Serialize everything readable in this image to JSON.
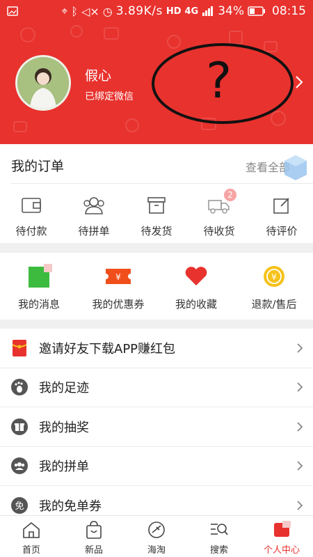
{
  "status_bar": {
    "speed": "3.89K/s",
    "hd": "HD",
    "net": "4G",
    "battery": "34%",
    "time": "08:15"
  },
  "profile": {
    "username": "假心",
    "wechat_status": "已绑定微信",
    "scribble_text": "?"
  },
  "orders": {
    "title": "我的订单",
    "view_all": "查看全部",
    "items": [
      {
        "label": "待付款",
        "icon": "wallet-icon"
      },
      {
        "label": "待拼单",
        "icon": "group-icon"
      },
      {
        "label": "待发货",
        "icon": "box-icon"
      },
      {
        "label": "待收货",
        "icon": "truck-icon",
        "badge": "2"
      },
      {
        "label": "待评价",
        "icon": "edit-icon"
      }
    ]
  },
  "quick": {
    "items": [
      {
        "label": "我的消息",
        "icon": "message-icon"
      },
      {
        "label": "我的优惠券",
        "icon": "coupon-icon"
      },
      {
        "label": "我的收藏",
        "icon": "heart-icon"
      },
      {
        "label": "退款/售后",
        "icon": "refund-icon"
      }
    ]
  },
  "menu": {
    "items": [
      {
        "label": "邀请好友下载APP赚红包",
        "icon": "red-envelope-icon"
      },
      {
        "label": "我的足迹",
        "icon": "footprint-icon"
      },
      {
        "label": "我的抽奖",
        "icon": "gift-icon"
      },
      {
        "label": "我的拼单",
        "icon": "group-buy-icon"
      },
      {
        "label": "我的免单券",
        "icon": "free-coupon-icon",
        "glyph": "免"
      }
    ]
  },
  "bottom_nav": {
    "items": [
      {
        "label": "首页",
        "icon": "home-icon"
      },
      {
        "label": "新品",
        "icon": "bag-icon"
      },
      {
        "label": "海淘",
        "icon": "plane-icon"
      },
      {
        "label": "搜索",
        "icon": "search-icon"
      },
      {
        "label": "个人中心",
        "icon": "profile-icon",
        "active": true
      }
    ]
  },
  "colors": {
    "brand": "#e8322e",
    "coupon": "#f04f1b",
    "refund": "#f5c21b",
    "message": "#3cbb3f"
  }
}
